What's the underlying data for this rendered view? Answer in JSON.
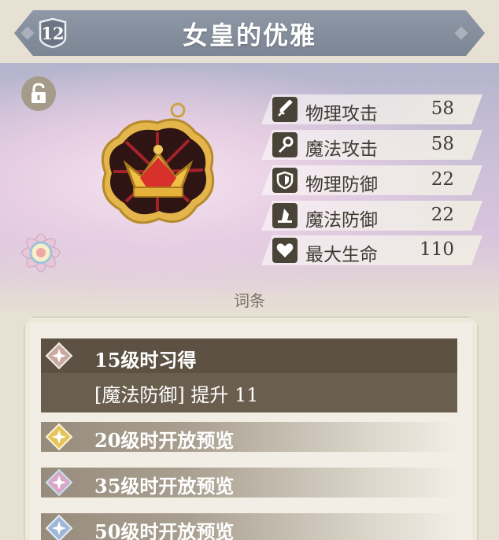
{
  "header": {
    "level": "12",
    "title": "女皇的优雅"
  },
  "item": {
    "name_icon": "crown-pendant-icon",
    "lock_icon": "unlock-icon",
    "rarity_icon": "rarity-flower-emblem-icon"
  },
  "stats": [
    {
      "icon": "sword-icon",
      "label": "物理攻击",
      "value": "58"
    },
    {
      "icon": "staff-icon",
      "label": "魔法攻击",
      "value": "58"
    },
    {
      "icon": "shield-icon",
      "label": "物理防御",
      "value": "22"
    },
    {
      "icon": "wizard-hat-icon",
      "label": "魔法防御",
      "value": "22"
    },
    {
      "icon": "heart-icon",
      "label": "最大生命",
      "value": "110"
    }
  ],
  "affix_section": {
    "title": "词条",
    "active": {
      "title": "15级时习得",
      "description": "[魔法防御] 提升 11",
      "gem_color": "#c8aaa0"
    },
    "locked": [
      {
        "title": "20级时开放预览",
        "gem_color": "#e6c45a"
      },
      {
        "title": "35级时开放预览",
        "gem_color": "#d9a6c8"
      },
      {
        "title": "50级时开放预览",
        "gem_color": "#9fb6d6"
      }
    ]
  },
  "colors": {
    "header_bg": "#828b99",
    "text_dark": "#3f3a32",
    "active_row": "#6a5e4f"
  }
}
